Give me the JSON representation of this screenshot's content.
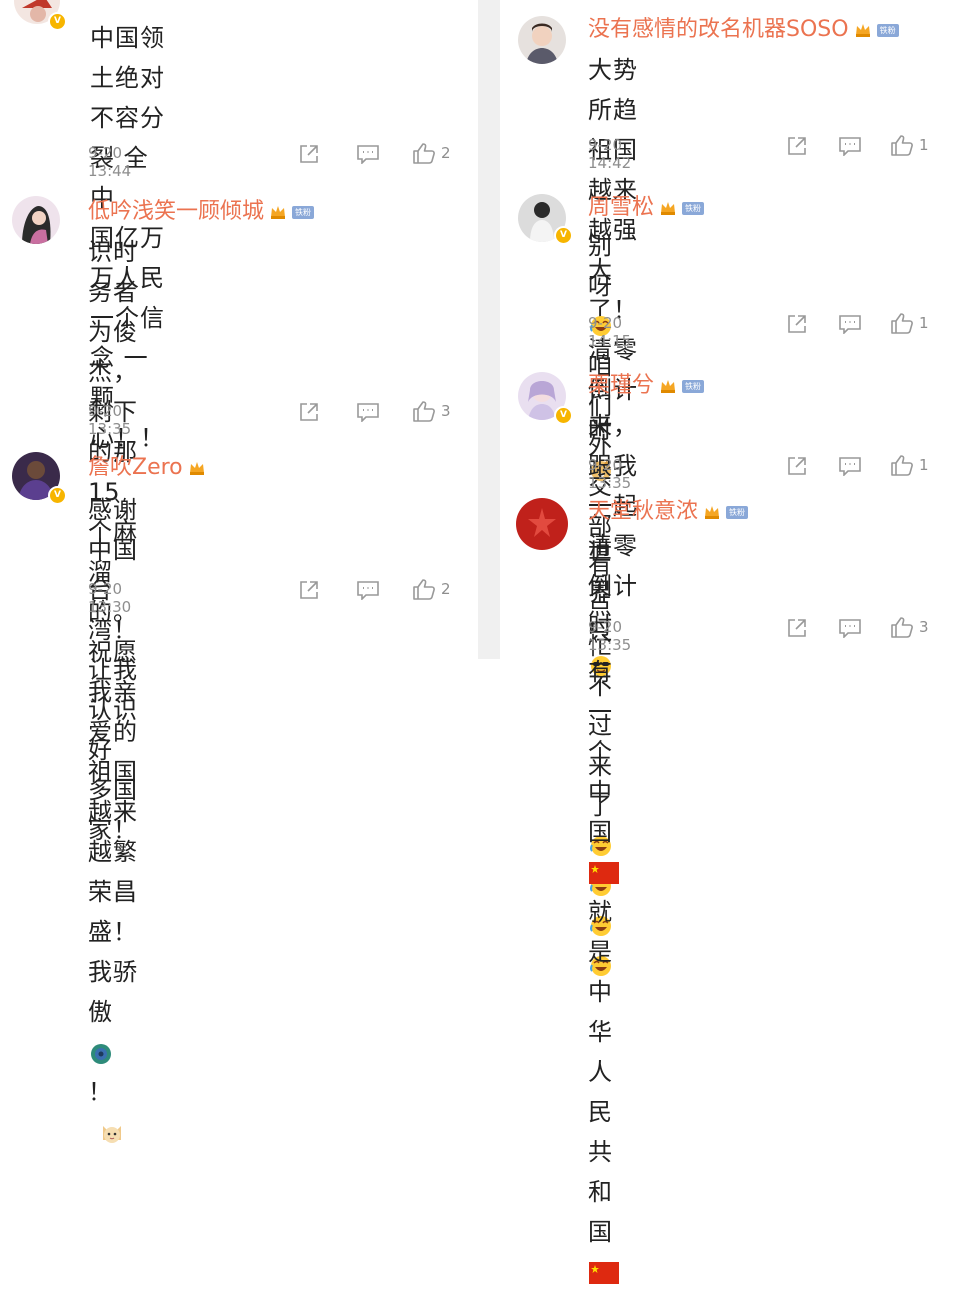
{
  "left": [
    {
      "name": "",
      "text": [
        "中国领土绝对不容分裂 全中",
        "国亿万万人民一个信念 一颗",
        "心！！"
      ],
      "time": "9-20 13:44",
      "likes": "2"
    },
    {
      "name": "低吟浅笑一顾倾城",
      "fan_badge": "铁粉",
      "text": [
        "识时务者为俊杰，剩下的那",
        "15个麻溜的。祝愿我亲爱的",
        "祖国越来越繁荣昌盛！我骄",
        "傲"
      ],
      "text_tail": "！",
      "time": "9-20 13:35",
      "likes": "3"
    },
    {
      "name": "詹吹Zero",
      "text": [
        "感谢中国台湾！让我认识好",
        "多国家！"
      ],
      "time": "9-20 13:30",
      "likes": "2"
    }
  ],
  "right": [
    {
      "name": "没有感情的改名机器SOSO",
      "fan_badge": "铁粉",
      "text": [
        "大势所趋 祖国越来越强大",
        "了！清零倒计时"
      ],
      "time": "9-20 14:42",
      "likes": "1"
    },
    {
      "name": "周雪松",
      "fan_badge": "铁粉",
      "text": [
        "别呀",
        "咱们外交部有点忙不",
        "过来了"
      ],
      "time": "9-20 14:15",
      "likes": "1"
    },
    {
      "name": "栗瑾兮",
      "fan_badge": "铁粉",
      "text": [
        "来，跟我一起清零倒计时"
      ],
      "time": "9-20 13:35",
      "likes": "1"
    },
    {
      "name": "天堂秋意浓",
      "fan_badge": "铁粉",
      "text": [
        "世界只有一个中国",
        " 就是中",
        "华人民共和国"
      ],
      "time": "9-20 13:35",
      "likes": "3"
    }
  ],
  "icons": {
    "share": "share-icon",
    "comment": "comment-icon",
    "like": "thumbs-up-icon",
    "verified": "verified-badge-icon",
    "crown": "crown-icon"
  },
  "colors": {
    "name": "#eb7350",
    "verified": "#f7b500",
    "fan_badge": "#8aa8d8",
    "meta": "#8e8e8e"
  }
}
